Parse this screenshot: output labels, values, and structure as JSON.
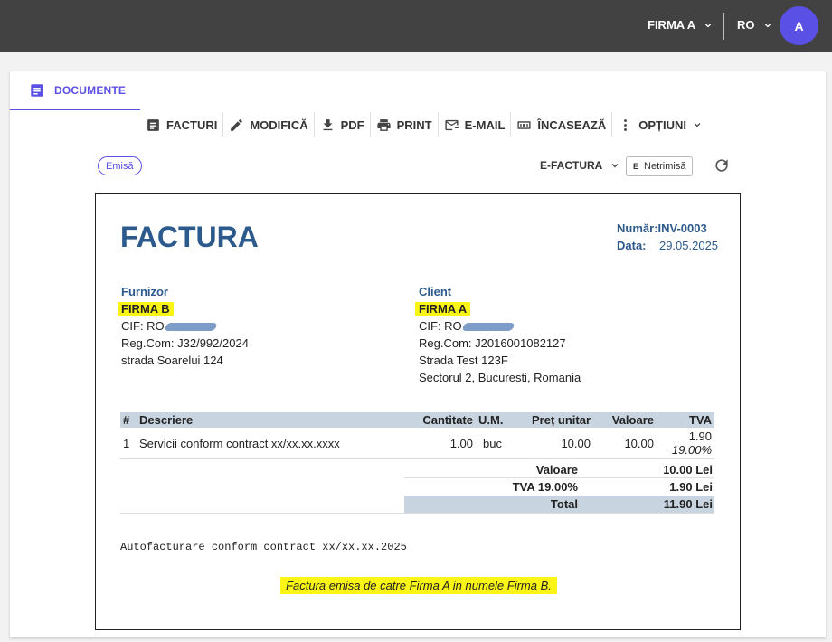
{
  "header": {
    "firm": "FIRMA A",
    "language": "RO",
    "avatar_letter": "A"
  },
  "tab": {
    "label": "DOCUMENTE"
  },
  "toolbar": [
    {
      "label": "FACTURI",
      "icon": "document-icon"
    },
    {
      "label": "MODIFICĂ",
      "icon": "pencil-icon"
    },
    {
      "label": "PDF",
      "icon": "download-icon"
    },
    {
      "label": "PRINT",
      "icon": "printer-icon"
    },
    {
      "label": "E-MAIL",
      "icon": "email-icon"
    },
    {
      "label": "ÎNCASEAZĂ",
      "icon": "cash-icon"
    },
    {
      "label": "OPȚIUNI",
      "icon": "more-vertical-icon"
    }
  ],
  "status": {
    "badge": "Emisă",
    "efactura_label": "E-FACTURA",
    "efactura_status_letter": "E",
    "efactura_status": "Netrimisă"
  },
  "invoice": {
    "title": "FACTURA",
    "number_label": "Număr:",
    "number": "INV-0003",
    "date_label": "Data:",
    "date": "29.05.2025",
    "supplier": {
      "label": "Furnizor",
      "name": "FIRMA B",
      "cif_prefix": "CIF: RO",
      "regcom": "Reg.Com: J32/992/2024",
      "address": "strada Soarelui 124"
    },
    "client": {
      "label": "Client",
      "name": "FIRMA A",
      "cif_prefix": "CIF: RO",
      "regcom": "Reg.Com: J2016001082127",
      "address1": "Strada Test 123F",
      "address2": "Sectorul 2, Bucuresti, Romania"
    },
    "columns": [
      "#",
      "Descriere",
      "Cantitate",
      "U.M.",
      "Preț unitar",
      "Valoare",
      "TVA"
    ],
    "items": [
      {
        "nr": "1",
        "desc": "Servicii conform contract xx/xx.xx.xxxx",
        "qty": "1.00",
        "um": "buc",
        "price": "10.00",
        "value": "10.00",
        "vat": "1.90",
        "vat_rate": "19.00%"
      }
    ],
    "totals": [
      {
        "label": "Valoare",
        "value": "10.00 Lei"
      },
      {
        "label": "TVA 19.00%",
        "value": "1.90 Lei"
      },
      {
        "label": "Total",
        "value": "11.90 Lei"
      }
    ],
    "note": "Autofacturare conform contract xx/xx.xx.2025",
    "footer": "Factura emisa de catre Firma A in numele Firma B."
  }
}
